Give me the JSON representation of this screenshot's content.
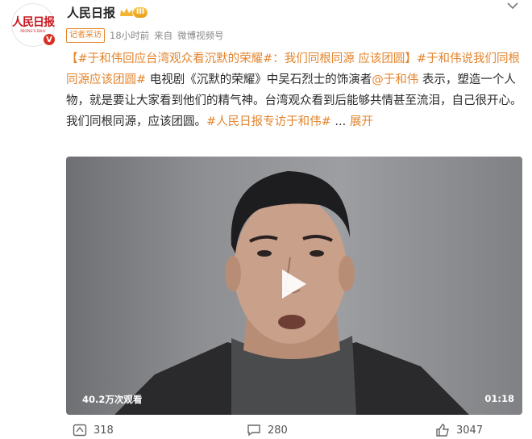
{
  "header": {
    "avatar_logo": "人民日报",
    "avatar_logo_sub": "PEOPLE'S DAILY",
    "verified_mark": "V",
    "username": "人民日报",
    "level": "III",
    "tag": "记者采访",
    "time": "18小时前",
    "source_prefix": "来自",
    "source": "微博视频号"
  },
  "post": {
    "topic1": "【#于和伟回应台湾观众看沉默的荣耀#：我们同根同源 应该团圆】",
    "topic2": "#于和伟说我们同根同源应该团圆#",
    "text1": " 电视剧《沉默的荣耀》中吴石烈士的饰演者",
    "mention": "@于和伟",
    "text2": " 表示，塑造一个人物，就是要让大家看到他们的精气神。台湾观众看到后能够共情甚至流泪，自己很开心。我们同根同源，应该团圆。",
    "topic3": "#人民日报专访于和伟#",
    "ellipsis": " ...",
    "expand": "展开"
  },
  "video": {
    "views": "40.2万次观看",
    "duration": "01:18"
  },
  "actions": {
    "repost_count": "318",
    "comment_count": "280",
    "like_count": "3047"
  }
}
